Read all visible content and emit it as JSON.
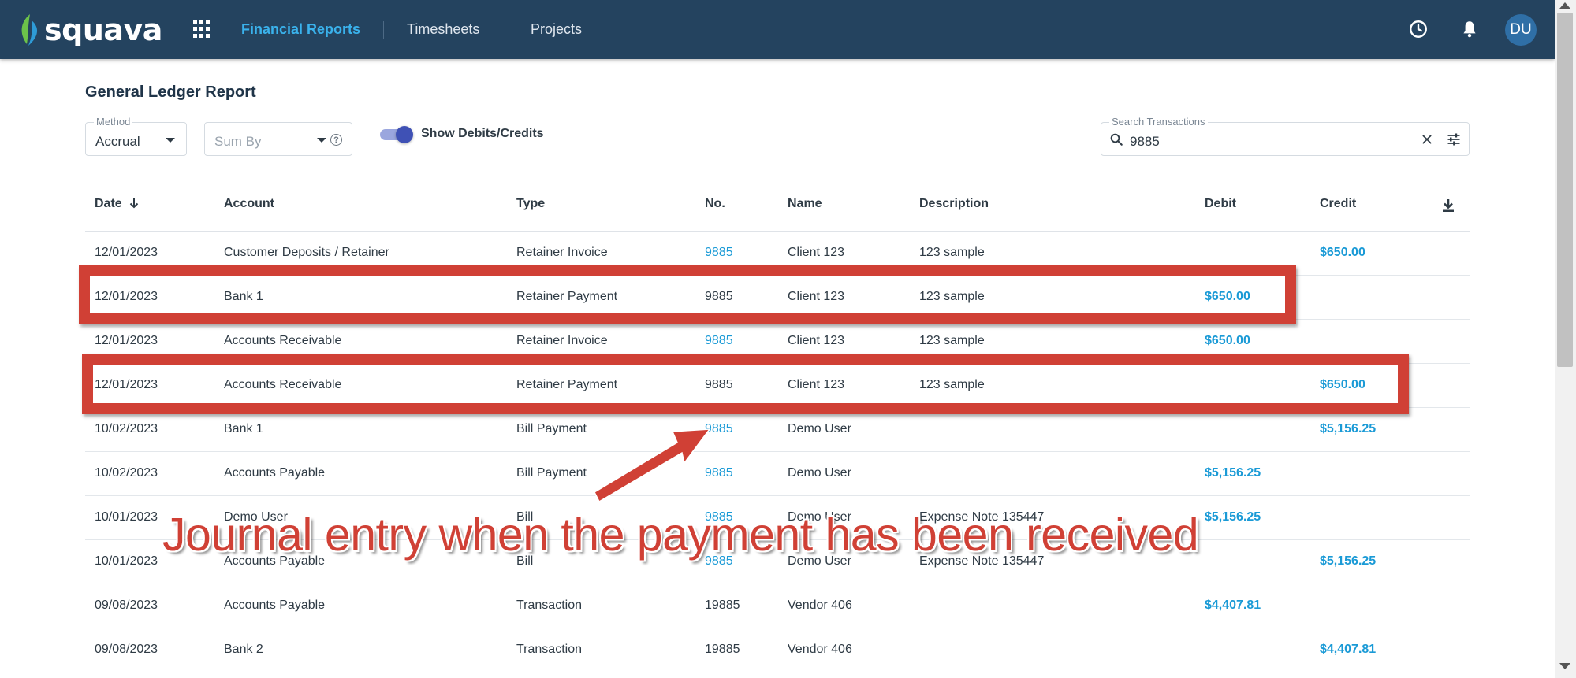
{
  "app": {
    "logo_text": "squava",
    "nav": [
      {
        "label": "Financial Reports",
        "active": true
      },
      {
        "label": "Timesheets",
        "active": false
      },
      {
        "label": "Projects",
        "active": false
      }
    ],
    "avatar_initials": "DU",
    "icons": [
      "apps-grid-icon",
      "clock-icon",
      "bell-icon"
    ]
  },
  "page": {
    "title": "General Ledger Report",
    "method": {
      "label": "Method",
      "value": "Accrual"
    },
    "sum_by": {
      "placeholder": "Sum By"
    },
    "toggle": {
      "label": "Show Debits/Credits",
      "on": true
    },
    "search": {
      "label": "Search Transactions",
      "value": "9885"
    }
  },
  "table": {
    "columns": [
      "Date",
      "Account",
      "Type",
      "No.",
      "Name",
      "Description",
      "Debit",
      "Credit"
    ],
    "sort_icon": "arrow-down-icon",
    "export_icon": "download-icon",
    "rows": [
      {
        "date": "12/01/2023",
        "account": "Customer Deposits / Retainer",
        "type": "Retainer Invoice",
        "no": "9885",
        "no_link": true,
        "name": "Client 123",
        "description": "123 sample",
        "debit": "",
        "credit": "$650.00"
      },
      {
        "date": "12/01/2023",
        "account": "Bank 1",
        "type": "Retainer Payment",
        "no": "9885",
        "no_link": false,
        "name": "Client 123",
        "description": "123 sample",
        "debit": "$650.00",
        "credit": ""
      },
      {
        "date": "12/01/2023",
        "account": "Accounts Receivable",
        "type": "Retainer Invoice",
        "no": "9885",
        "no_link": true,
        "name": "Client 123",
        "description": "123 sample",
        "debit": "$650.00",
        "credit": ""
      },
      {
        "date": "12/01/2023",
        "account": "Accounts Receivable",
        "type": "Retainer Payment",
        "no": "9885",
        "no_link": false,
        "name": "Client 123",
        "description": "123 sample",
        "debit": "",
        "credit": "$650.00"
      },
      {
        "date": "10/02/2023",
        "account": "Bank 1",
        "type": "Bill Payment",
        "no": "9885",
        "no_link": true,
        "name": "Demo User",
        "description": "",
        "debit": "",
        "credit": "$5,156.25"
      },
      {
        "date": "10/02/2023",
        "account": "Accounts Payable",
        "type": "Bill Payment",
        "no": "9885",
        "no_link": true,
        "name": "Demo User",
        "description": "",
        "debit": "$5,156.25",
        "credit": ""
      },
      {
        "date": "10/01/2023",
        "account": "Demo User",
        "type": "Bill",
        "no": "9885",
        "no_link": true,
        "name": "Demo User",
        "description": "Expense Note 135447",
        "debit": "$5,156.25",
        "credit": ""
      },
      {
        "date": "10/01/2023",
        "account": "Accounts Payable",
        "type": "Bill",
        "no": "9885",
        "no_link": true,
        "name": "Demo User",
        "description": "Expense Note 135447",
        "debit": "",
        "credit": "$5,156.25"
      },
      {
        "date": "09/08/2023",
        "account": "Accounts Payable",
        "type": "Transaction",
        "no": "19885",
        "no_link": false,
        "name": "Vendor 406",
        "description": "",
        "debit": "$4,407.81",
        "credit": ""
      },
      {
        "date": "09/08/2023",
        "account": "Bank 2",
        "type": "Transaction",
        "no": "19885",
        "no_link": false,
        "name": "Vendor 406",
        "description": "",
        "debit": "",
        "credit": "$4,407.81"
      }
    ]
  },
  "annotation": {
    "callout": "Journal entry when the payment has been received",
    "highlight_color": "#d04035"
  }
}
